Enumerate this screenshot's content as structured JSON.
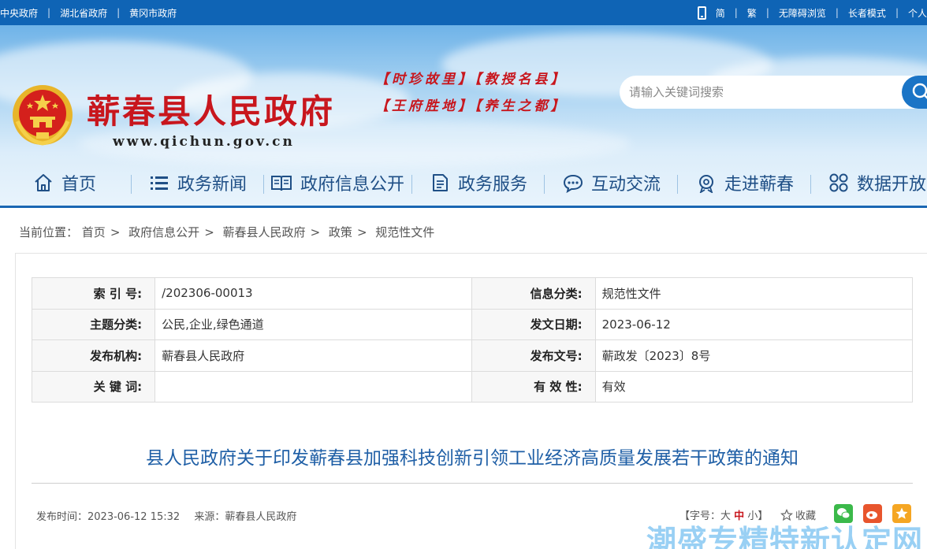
{
  "topbar": {
    "links": [
      "中央政府",
      "湖北省政府",
      "黄冈市政府"
    ],
    "right": {
      "simplified": "简",
      "traditional": "繁",
      "accessible": "无障碍浏览",
      "elder": "长者模式",
      "personal": "个人"
    }
  },
  "header": {
    "site_title": "蕲春县人民政府",
    "site_url": "www.qichun.gov.cn",
    "slogan_line1": "【时珍故里】【教授名县】",
    "slogan_line2": "【王府胜地】【养生之都】",
    "search_placeholder": "请输入关键词搜索"
  },
  "nav": {
    "items": [
      {
        "label": "首页",
        "icon": "home-icon"
      },
      {
        "label": "政务新闻",
        "icon": "list-icon"
      },
      {
        "label": "政府信息公开",
        "icon": "book-icon"
      },
      {
        "label": "政务服务",
        "icon": "document-icon"
      },
      {
        "label": "互动交流",
        "icon": "chat-icon"
      },
      {
        "label": "走进蕲春",
        "icon": "badge-icon"
      },
      {
        "label": "数据开放",
        "icon": "grid-icon"
      }
    ]
  },
  "breadcrumb": {
    "prefix": "当前位置：",
    "items": [
      "首页",
      "政府信息公开",
      "蕲春县人民政府",
      "政策",
      "规范性文件"
    ]
  },
  "meta": {
    "rows": [
      {
        "k1": "索 引 号:",
        "v1": "/202306-00013",
        "k2": "信息分类:",
        "v2": "规范性文件"
      },
      {
        "k1": "主题分类:",
        "v1": "公民,企业,绿色通道",
        "k2": "发文日期:",
        "v2": "2023-06-12"
      },
      {
        "k1": "发布机构:",
        "v1": "蕲春县人民政府",
        "k2": "发布文号:",
        "v2": "蕲政发〔2023〕8号"
      },
      {
        "k1": "关 键 词:",
        "v1": "",
        "k2": "有 效 性:",
        "v2": "有效"
      }
    ]
  },
  "article": {
    "title": "县人民政府关于印发蕲春县加强科技创新引领工业经济高质量发展若干政策的通知",
    "publish_label": "发布时间：",
    "publish_time": "2023-06-12 15:32",
    "source_label": "来源：",
    "source": "蕲春县人民政府",
    "fontsize_label": "【字号：",
    "fontsize_large": "大",
    "fontsize_medium": "中",
    "fontsize_small": "小",
    "fontsize_end": "】",
    "collect": "收藏"
  },
  "watermark": "潮盛专精特新认定网",
  "colors": {
    "topbar": "#0f64b5",
    "title_red": "#c8161d",
    "nav_text": "#1f4f86",
    "doc_title": "#1f5fa6",
    "wechat": "#3bb94a",
    "weibo": "#e8552d",
    "qzone": "#f5a623"
  }
}
